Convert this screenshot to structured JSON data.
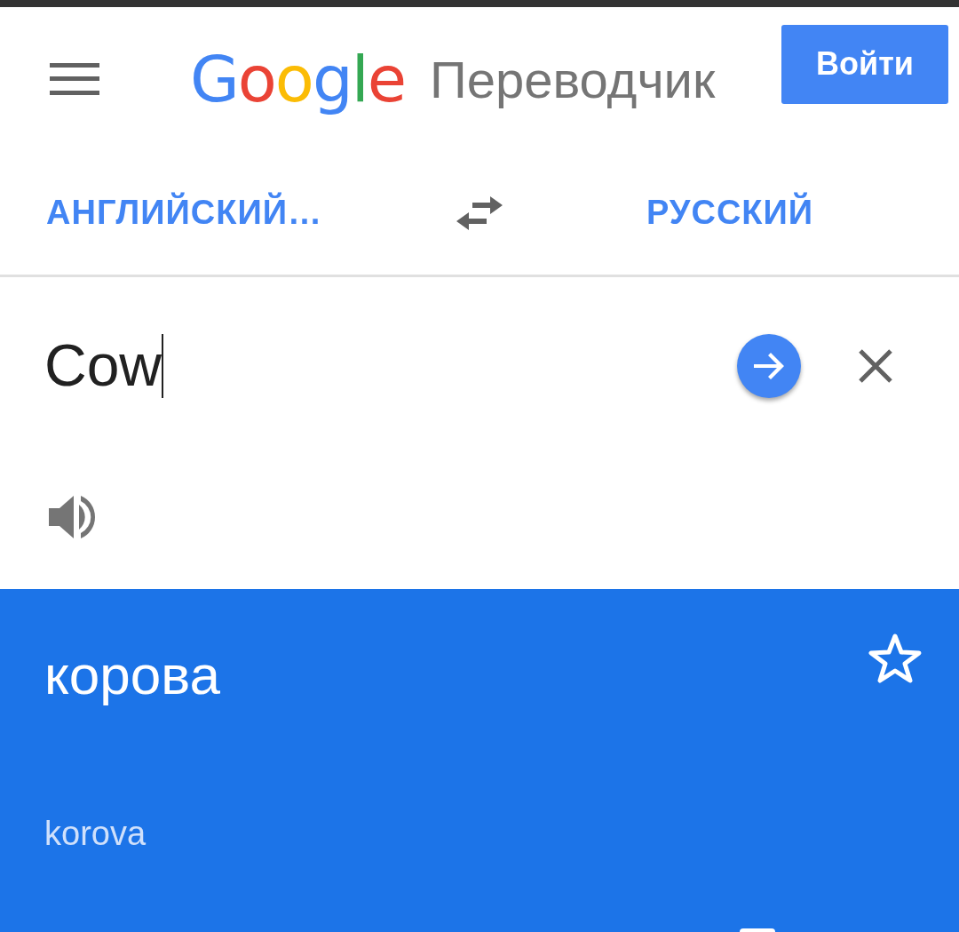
{
  "header": {
    "logo": "Google",
    "product": "Переводчик",
    "sign_in": "Войти"
  },
  "languages": {
    "source": "АНГЛИЙСКИЙ…",
    "target": "РУССКИЙ"
  },
  "input": {
    "value": "Cow"
  },
  "translation": {
    "text": "корова",
    "transliteration": "korova",
    "starred": false
  }
}
